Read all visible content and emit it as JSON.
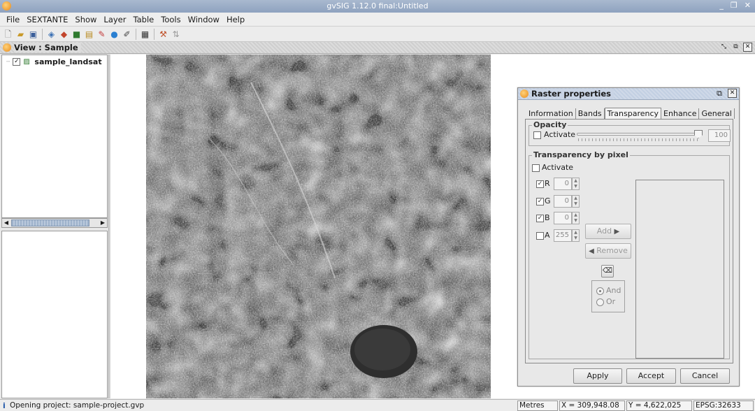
{
  "window": {
    "title": "gvSIG 1.12.0 final:Untitled",
    "controls": [
      "_",
      "❐",
      "✕"
    ]
  },
  "menubar": {
    "items": [
      "File",
      "SEXTANTE",
      "Show",
      "Layer",
      "Table",
      "Tools",
      "Window",
      "Help"
    ]
  },
  "toolbar": {
    "icons": [
      "new-document-icon",
      "open-folder-icon",
      "save-icon",
      "layers-icon",
      "shapes-icon",
      "map-icon",
      "table-icon",
      "paint-icon",
      "globe-icon",
      "edit-icon",
      "grid-icon",
      "tools-icon",
      "script-icon"
    ]
  },
  "view": {
    "title": "View : Sample"
  },
  "toc": {
    "layer_name": "sample_landsat",
    "layer_checked": true
  },
  "dialog": {
    "title": "Raster properties",
    "tabs": [
      "Information",
      "Bands",
      "Transparency",
      "Enhance",
      "General"
    ],
    "active_tab": "Transparency",
    "opacity": {
      "legend": "Opacity",
      "activate_label": "Activate",
      "activate_checked": false,
      "value": "100",
      "slider_fraction": 1.0
    },
    "transparency_by_pixel": {
      "legend": "Transparency by pixel",
      "activate_label": "Activate",
      "activate_checked": false,
      "channels": [
        {
          "label": "R",
          "checked": true,
          "value": "0"
        },
        {
          "label": "G",
          "checked": true,
          "value": "0"
        },
        {
          "label": "B",
          "checked": true,
          "value": "0"
        },
        {
          "label": "A",
          "checked": false,
          "value": "255"
        }
      ],
      "add_label": "Add",
      "remove_label": "Remove",
      "and_label": "And",
      "or_label": "Or",
      "selected_operator": "And"
    },
    "buttons": {
      "apply": "Apply",
      "accept": "Accept",
      "cancel": "Cancel"
    }
  },
  "statusbar": {
    "message": "Opening project: sample-project.gvp",
    "units": "Metres",
    "x": "X = 309,948.08",
    "y": "Y = 4,622,025",
    "epsg": "EPSG:32633"
  }
}
